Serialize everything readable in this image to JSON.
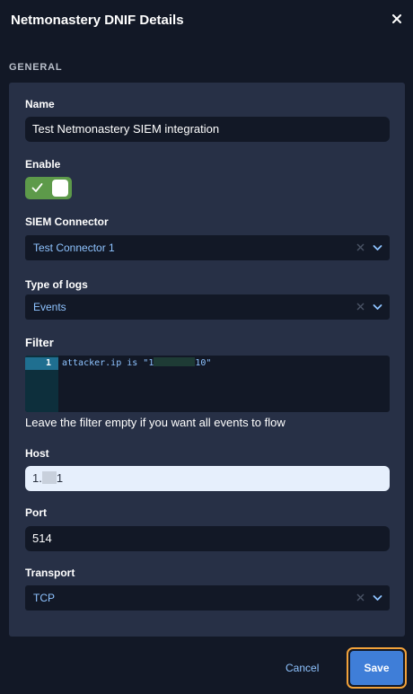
{
  "dialog": {
    "title": "Netmonastery DNIF Details",
    "section": "GENERAL"
  },
  "form": {
    "name": {
      "label": "Name",
      "value": "Test Netmonastery SIEM integration"
    },
    "enable": {
      "label": "Enable",
      "on": true
    },
    "siem_connector": {
      "label": "SIEM Connector",
      "value": "Test Connector 1"
    },
    "type_of_logs": {
      "label": "Type of logs",
      "value": "Events"
    },
    "filter": {
      "label": "Filter",
      "line_number": "1",
      "code_prefix": "attacker.ip is \"1",
      "code_suffix": "10\"",
      "hint": "Leave the filter empty if you want all events to flow"
    },
    "host": {
      "label": "Host",
      "value_prefix": "1.",
      "value_suffix": "1"
    },
    "port": {
      "label": "Port",
      "value": "514"
    },
    "transport": {
      "label": "Transport",
      "value": "TCP"
    }
  },
  "footer": {
    "cancel_label": "Cancel",
    "save_label": "Save"
  },
  "colors": {
    "background": "#121826",
    "panel": "#273046",
    "accent_link": "#8ec3ff",
    "toggle_on": "#5d9a4a",
    "save_button": "#3f7ed8",
    "focus_ring": "#f2a23a"
  },
  "icons": [
    "close-icon",
    "check-icon",
    "clear-icon",
    "chevron-down-icon"
  ]
}
